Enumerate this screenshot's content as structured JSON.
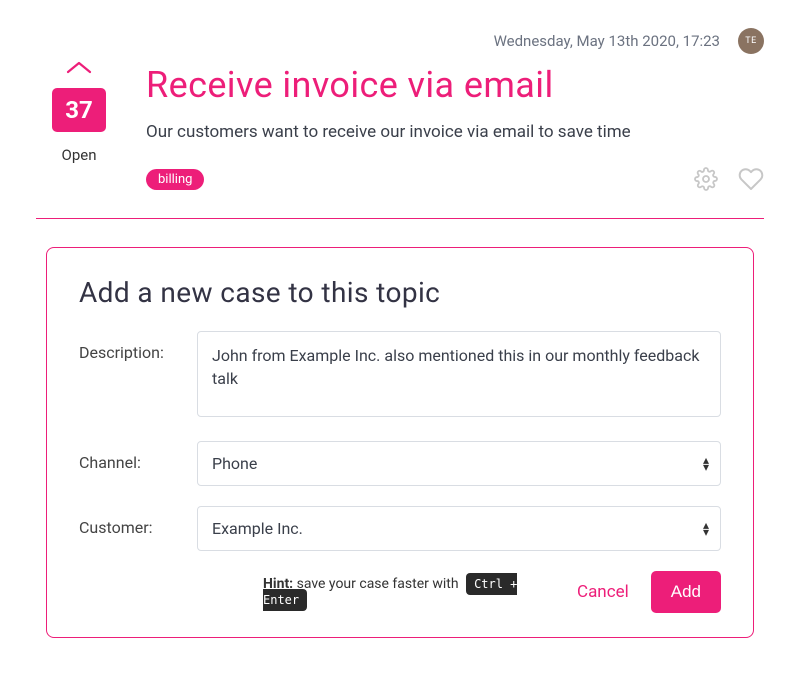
{
  "topbar": {
    "timestamp": "Wednesday, May 13th 2020, 17:23",
    "avatar_initials": "TE"
  },
  "topic": {
    "votes": "37",
    "status": "Open",
    "title": "Receive invoice via email",
    "description": "Our customers want to receive our invoice via email to save time",
    "tag": "billing"
  },
  "form": {
    "title": "Add a new case to this topic",
    "labels": {
      "description": "Description:",
      "channel": "Channel:",
      "customer": "Customer:"
    },
    "description_value": "John from Example Inc. also mentioned this in our monthly feedback talk",
    "channel_value": "Phone",
    "customer_value": "Example Inc.",
    "hint_label": "Hint:",
    "hint_text": " save your case faster with ",
    "hint_kbd": "Ctrl + Enter",
    "cancel": "Cancel",
    "add": "Add"
  }
}
